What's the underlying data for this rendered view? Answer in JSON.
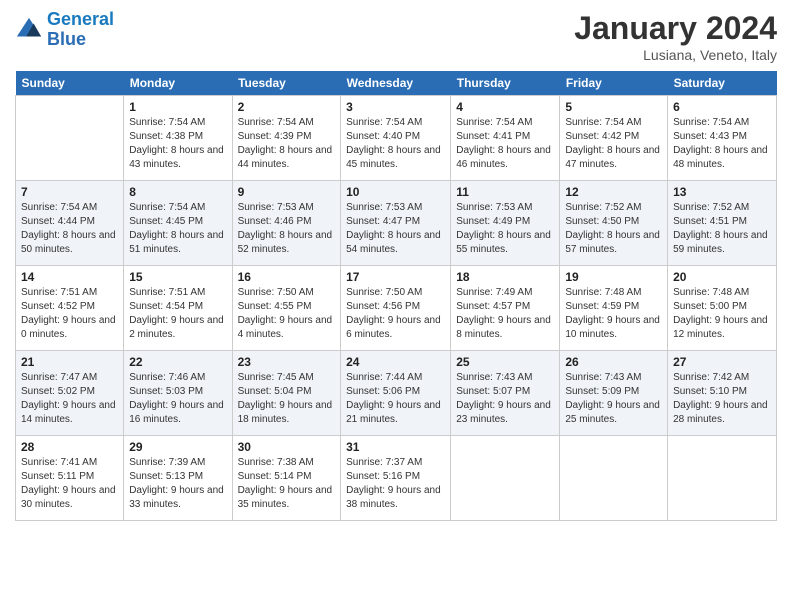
{
  "header": {
    "logo": {
      "line1": "General",
      "line2": "Blue"
    },
    "title": "January 2024",
    "location": "Lusiana, Veneto, Italy"
  },
  "days_of_week": [
    "Sunday",
    "Monday",
    "Tuesday",
    "Wednesday",
    "Thursday",
    "Friday",
    "Saturday"
  ],
  "weeks": [
    [
      {
        "date": "",
        "empty": true
      },
      {
        "date": "1",
        "sunrise": "7:54 AM",
        "sunset": "4:38 PM",
        "daylight": "8 hours and 43 minutes."
      },
      {
        "date": "2",
        "sunrise": "7:54 AM",
        "sunset": "4:39 PM",
        "daylight": "8 hours and 44 minutes."
      },
      {
        "date": "3",
        "sunrise": "7:54 AM",
        "sunset": "4:40 PM",
        "daylight": "8 hours and 45 minutes."
      },
      {
        "date": "4",
        "sunrise": "7:54 AM",
        "sunset": "4:41 PM",
        "daylight": "8 hours and 46 minutes."
      },
      {
        "date": "5",
        "sunrise": "7:54 AM",
        "sunset": "4:42 PM",
        "daylight": "8 hours and 47 minutes."
      },
      {
        "date": "6",
        "sunrise": "7:54 AM",
        "sunset": "4:43 PM",
        "daylight": "8 hours and 48 minutes."
      }
    ],
    [
      {
        "date": "7",
        "sunrise": "7:54 AM",
        "sunset": "4:44 PM",
        "daylight": "8 hours and 50 minutes."
      },
      {
        "date": "8",
        "sunrise": "7:54 AM",
        "sunset": "4:45 PM",
        "daylight": "8 hours and 51 minutes."
      },
      {
        "date": "9",
        "sunrise": "7:53 AM",
        "sunset": "4:46 PM",
        "daylight": "8 hours and 52 minutes."
      },
      {
        "date": "10",
        "sunrise": "7:53 AM",
        "sunset": "4:47 PM",
        "daylight": "8 hours and 54 minutes."
      },
      {
        "date": "11",
        "sunrise": "7:53 AM",
        "sunset": "4:49 PM",
        "daylight": "8 hours and 55 minutes."
      },
      {
        "date": "12",
        "sunrise": "7:52 AM",
        "sunset": "4:50 PM",
        "daylight": "8 hours and 57 minutes."
      },
      {
        "date": "13",
        "sunrise": "7:52 AM",
        "sunset": "4:51 PM",
        "daylight": "8 hours and 59 minutes."
      }
    ],
    [
      {
        "date": "14",
        "sunrise": "7:51 AM",
        "sunset": "4:52 PM",
        "daylight": "9 hours and 0 minutes."
      },
      {
        "date": "15",
        "sunrise": "7:51 AM",
        "sunset": "4:54 PM",
        "daylight": "9 hours and 2 minutes."
      },
      {
        "date": "16",
        "sunrise": "7:50 AM",
        "sunset": "4:55 PM",
        "daylight": "9 hours and 4 minutes."
      },
      {
        "date": "17",
        "sunrise": "7:50 AM",
        "sunset": "4:56 PM",
        "daylight": "9 hours and 6 minutes."
      },
      {
        "date": "18",
        "sunrise": "7:49 AM",
        "sunset": "4:57 PM",
        "daylight": "9 hours and 8 minutes."
      },
      {
        "date": "19",
        "sunrise": "7:48 AM",
        "sunset": "4:59 PM",
        "daylight": "9 hours and 10 minutes."
      },
      {
        "date": "20",
        "sunrise": "7:48 AM",
        "sunset": "5:00 PM",
        "daylight": "9 hours and 12 minutes."
      }
    ],
    [
      {
        "date": "21",
        "sunrise": "7:47 AM",
        "sunset": "5:02 PM",
        "daylight": "9 hours and 14 minutes."
      },
      {
        "date": "22",
        "sunrise": "7:46 AM",
        "sunset": "5:03 PM",
        "daylight": "9 hours and 16 minutes."
      },
      {
        "date": "23",
        "sunrise": "7:45 AM",
        "sunset": "5:04 PM",
        "daylight": "9 hours and 18 minutes."
      },
      {
        "date": "24",
        "sunrise": "7:44 AM",
        "sunset": "5:06 PM",
        "daylight": "9 hours and 21 minutes."
      },
      {
        "date": "25",
        "sunrise": "7:43 AM",
        "sunset": "5:07 PM",
        "daylight": "9 hours and 23 minutes."
      },
      {
        "date": "26",
        "sunrise": "7:43 AM",
        "sunset": "5:09 PM",
        "daylight": "9 hours and 25 minutes."
      },
      {
        "date": "27",
        "sunrise": "7:42 AM",
        "sunset": "5:10 PM",
        "daylight": "9 hours and 28 minutes."
      }
    ],
    [
      {
        "date": "28",
        "sunrise": "7:41 AM",
        "sunset": "5:11 PM",
        "daylight": "9 hours and 30 minutes."
      },
      {
        "date": "29",
        "sunrise": "7:39 AM",
        "sunset": "5:13 PM",
        "daylight": "9 hours and 33 minutes."
      },
      {
        "date": "30",
        "sunrise": "7:38 AM",
        "sunset": "5:14 PM",
        "daylight": "9 hours and 35 minutes."
      },
      {
        "date": "31",
        "sunrise": "7:37 AM",
        "sunset": "5:16 PM",
        "daylight": "9 hours and 38 minutes."
      },
      {
        "date": "",
        "empty": true
      },
      {
        "date": "",
        "empty": true
      },
      {
        "date": "",
        "empty": true
      }
    ]
  ],
  "labels": {
    "sunrise": "Sunrise:",
    "sunset": "Sunset:",
    "daylight": "Daylight:"
  }
}
